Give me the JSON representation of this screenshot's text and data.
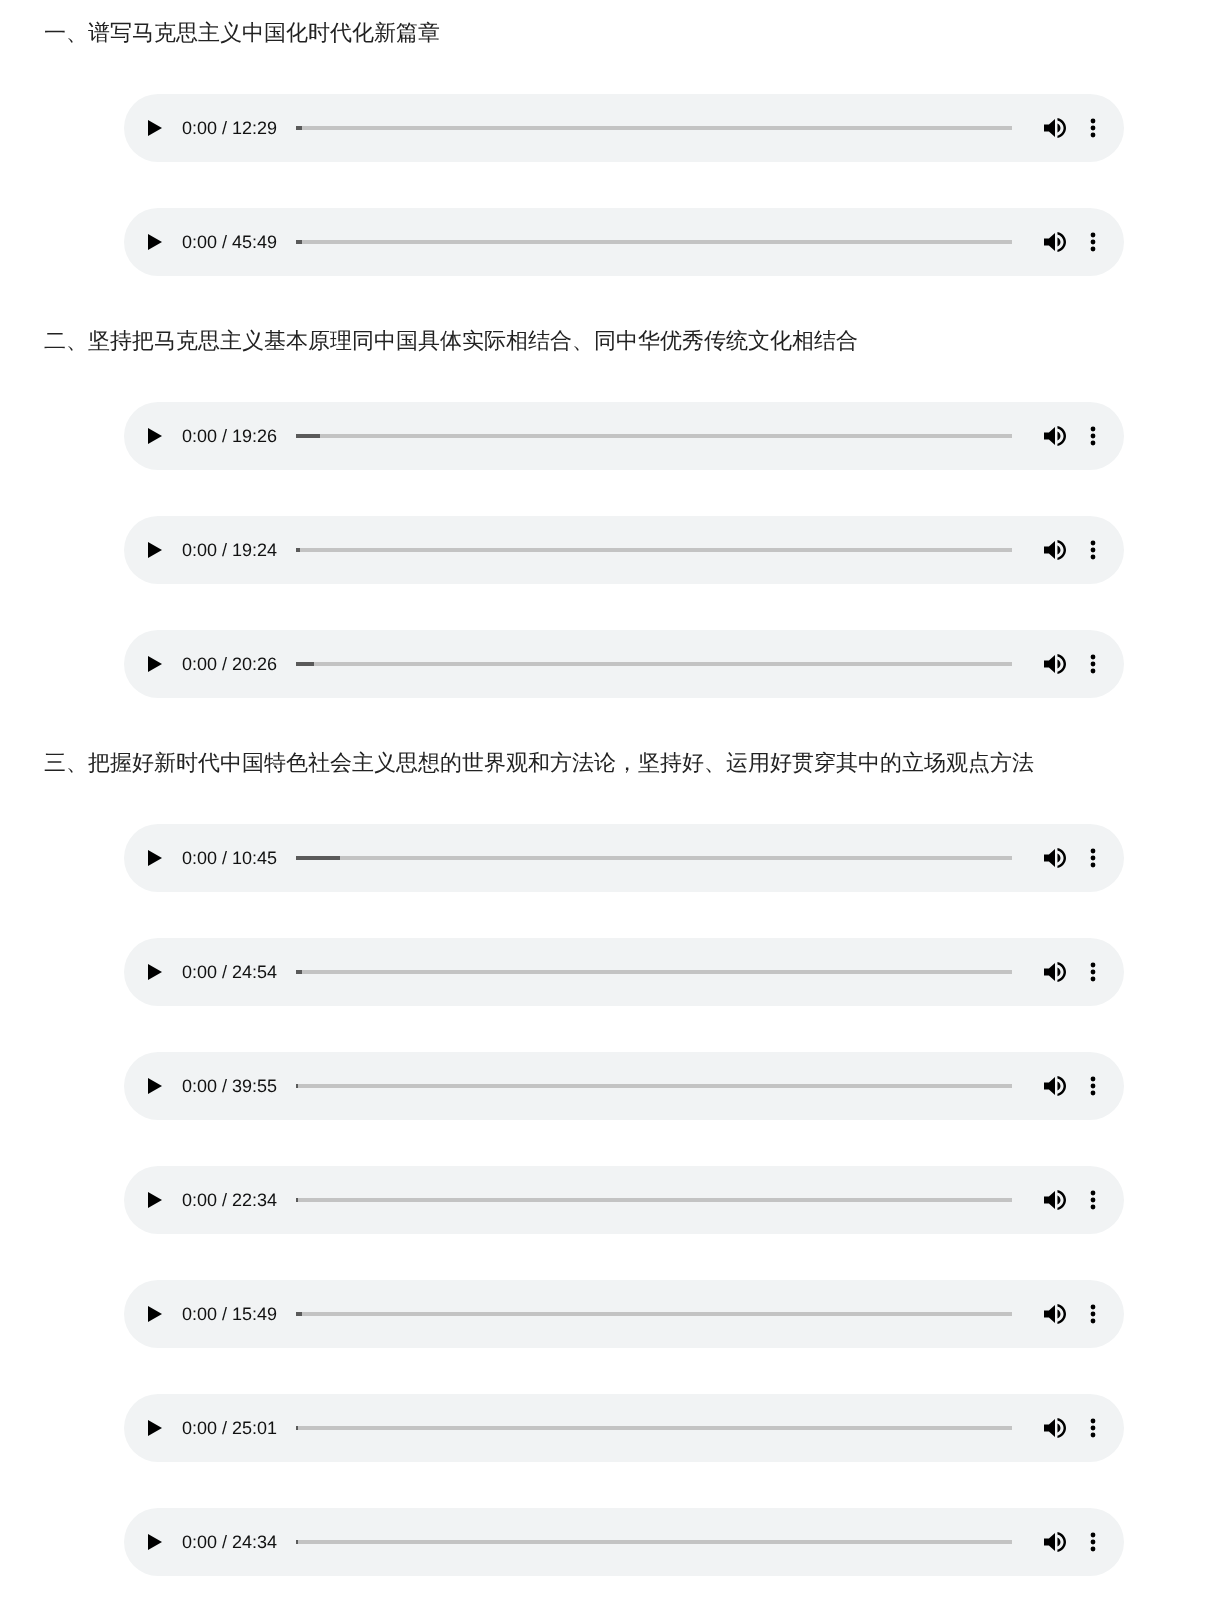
{
  "sections": [
    {
      "heading": "一、谱写马克思主义中国化时代化新篇章",
      "players": [
        {
          "time": "0:00 / 12:29",
          "level": 0.01
        },
        {
          "time": "0:00 / 45:49",
          "level": 0.01
        }
      ]
    },
    {
      "heading": "二、坚持把马克思主义基本原理同中国具体实际相结合、同中华优秀传统文化相结合",
      "players": [
        {
          "time": "0:00 / 19:26",
          "level": 0.035
        },
        {
          "time": "0:00 / 19:24",
          "level": 0.006
        },
        {
          "time": "0:00 / 20:26",
          "level": 0.026
        }
      ]
    },
    {
      "heading": "三、把握好新时代中国特色社会主义思想的世界观和方法论，坚持好、运用好贯穿其中的立场观点方法",
      "players": [
        {
          "time": "0:00 / 10:45",
          "level": 0.062
        },
        {
          "time": "0:00 / 24:54",
          "level": 0.01
        },
        {
          "time": "0:00 / 39:55",
          "level": 0
        },
        {
          "time": "0:00 / 22:34",
          "level": 0
        },
        {
          "time": "0:00 / 15:49",
          "level": 0.01
        },
        {
          "time": "0:00 / 25:01",
          "level": 0
        },
        {
          "time": "0:00 / 24:34",
          "level": 0
        }
      ]
    }
  ]
}
